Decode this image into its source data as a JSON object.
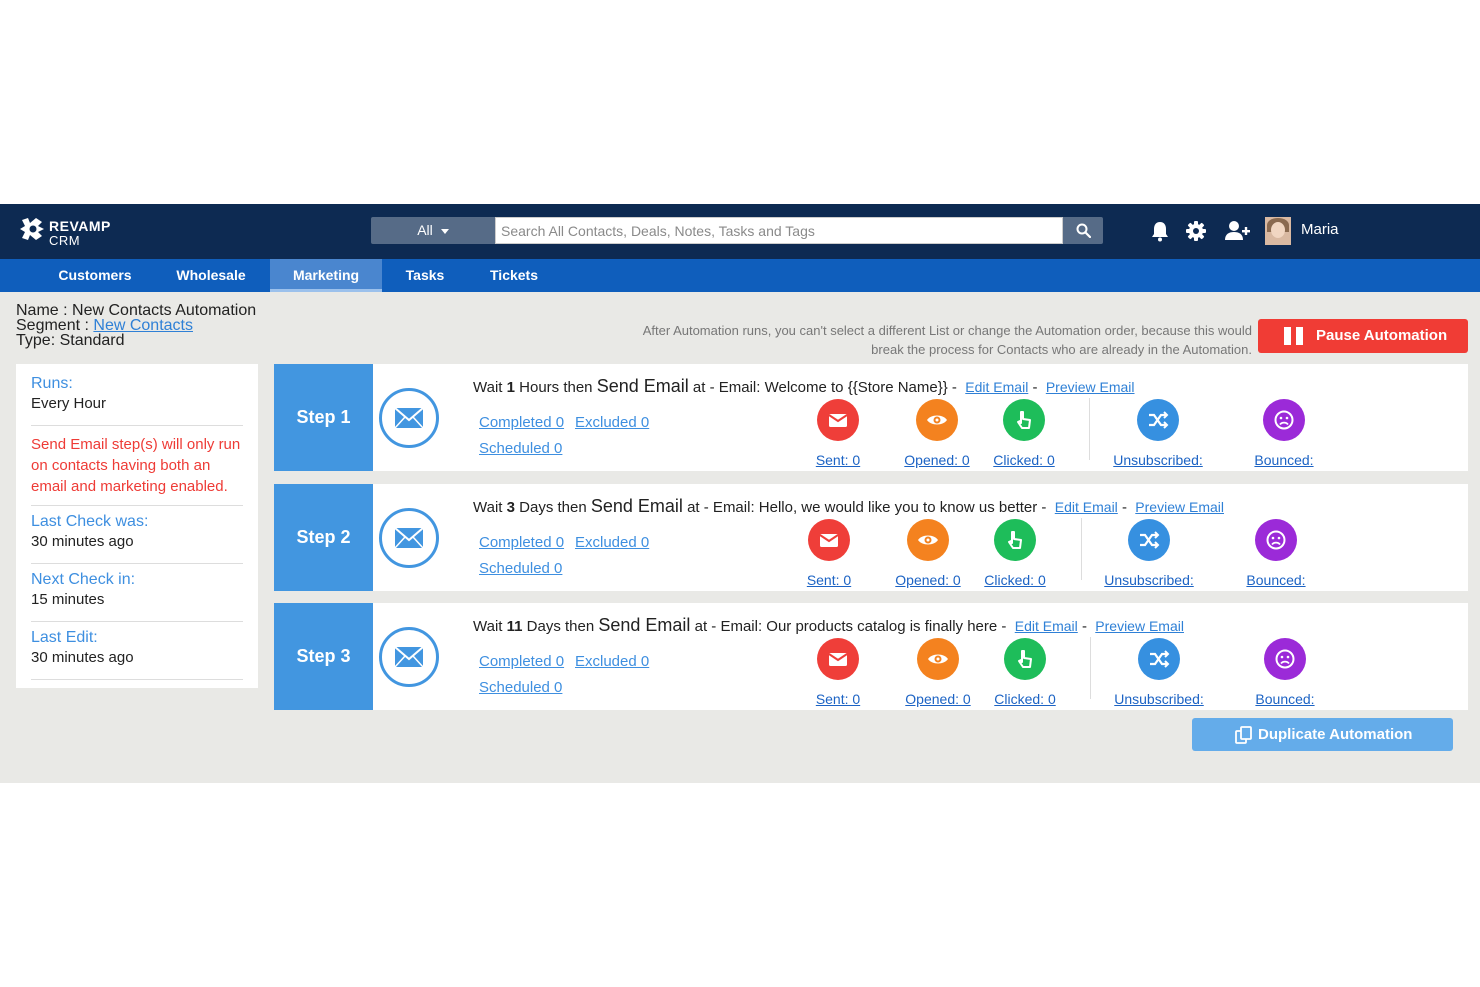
{
  "header": {
    "logo_top": "REVAMP",
    "logo_bottom": "CRM",
    "search_filter": "All",
    "search_placeholder": "Search All Contacts, Deals, Notes, Tasks and Tags",
    "user_name": "Maria"
  },
  "nav": {
    "items": [
      {
        "label": "Customers"
      },
      {
        "label": "Wholesale"
      },
      {
        "label": "Marketing",
        "active": true
      },
      {
        "label": "Tasks"
      },
      {
        "label": "Tickets"
      }
    ]
  },
  "automation": {
    "name_label": "Name :",
    "name": "New Contacts Automation",
    "segment_label": "Segment :",
    "segment": "New Contacts",
    "type_label": "Type:",
    "type": "Standard",
    "notice": "After Automation runs, you can't select a different List or change the Automation order, because this would break the process for Contacts who are already in the Automation.",
    "pause_label": "Pause Automation",
    "duplicate_label": "Duplicate Automation"
  },
  "sidebar": {
    "runs_title": "Runs:",
    "runs_value": "Every Hour",
    "warning": "Send Email step(s) will only run on contacts having both an email and marketing enabled.",
    "last_check_title": "Last Check was:",
    "last_check_value": "30 minutes ago",
    "next_check_title": "Next Check in:",
    "next_check_value": "15 minutes",
    "last_edit_title": "Last Edit:",
    "last_edit_value": "30 minutes ago"
  },
  "steps": [
    {
      "label": "Step 1",
      "wait_prefix": "Wait",
      "wait_amount": "1",
      "wait_unit": "Hours then",
      "action": "Send Email",
      "at_text": "at - Email: Welcome to {{Store Name}} -",
      "edit": "Edit Email",
      "preview": "Preview Email",
      "completed": "Completed 0",
      "excluded": "Excluded 0",
      "scheduled": "Scheduled 0",
      "sent": "Sent: 0",
      "opened": "Opened: 0",
      "clicked": "Clicked: 0",
      "unsubscribed": "Unsubscribed:",
      "bounced": "Bounced:"
    },
    {
      "label": "Step 2",
      "wait_prefix": "Wait",
      "wait_amount": "3",
      "wait_unit": "Days then",
      "action": "Send Email",
      "at_text": "at - Email: Hello, we would like you to know us better -",
      "edit": "Edit Email",
      "preview": "Preview Email",
      "completed": "Completed 0",
      "excluded": "Excluded 0",
      "scheduled": "Scheduled 0",
      "sent": "Sent: 0",
      "opened": "Opened: 0",
      "clicked": "Clicked: 0",
      "unsubscribed": "Unsubscribed:",
      "bounced": "Bounced:"
    },
    {
      "label": "Step 3",
      "wait_prefix": "Wait",
      "wait_amount": "11",
      "wait_unit": "Days then",
      "action": "Send Email",
      "at_text": "at - Email: Our products catalog is finally here -",
      "edit": "Edit Email",
      "preview": "Preview Email",
      "completed": "Completed 0",
      "excluded": "Excluded 0",
      "scheduled": "Scheduled 0",
      "sent": "Sent: 0",
      "opened": "Opened: 0",
      "clicked": "Clicked: 0",
      "unsubscribed": "Unsubscribed:",
      "bounced": "Bounced:"
    }
  ],
  "colors": {
    "topbar": "#0d2a52",
    "navbar": "#0f5ebc",
    "step_blue": "#4296e0",
    "sent": "#ef3e39",
    "opened": "#f4821f",
    "clicked": "#1ebd5a",
    "unsubscribed": "#3690e0",
    "bounced": "#9b2ad8",
    "pause": "#f03c35"
  },
  "icons": {
    "sent": "envelope-icon",
    "opened": "eye-icon",
    "clicked": "pointer-icon",
    "unsubscribed": "shuffle-icon",
    "bounced": "sad-face-icon"
  }
}
